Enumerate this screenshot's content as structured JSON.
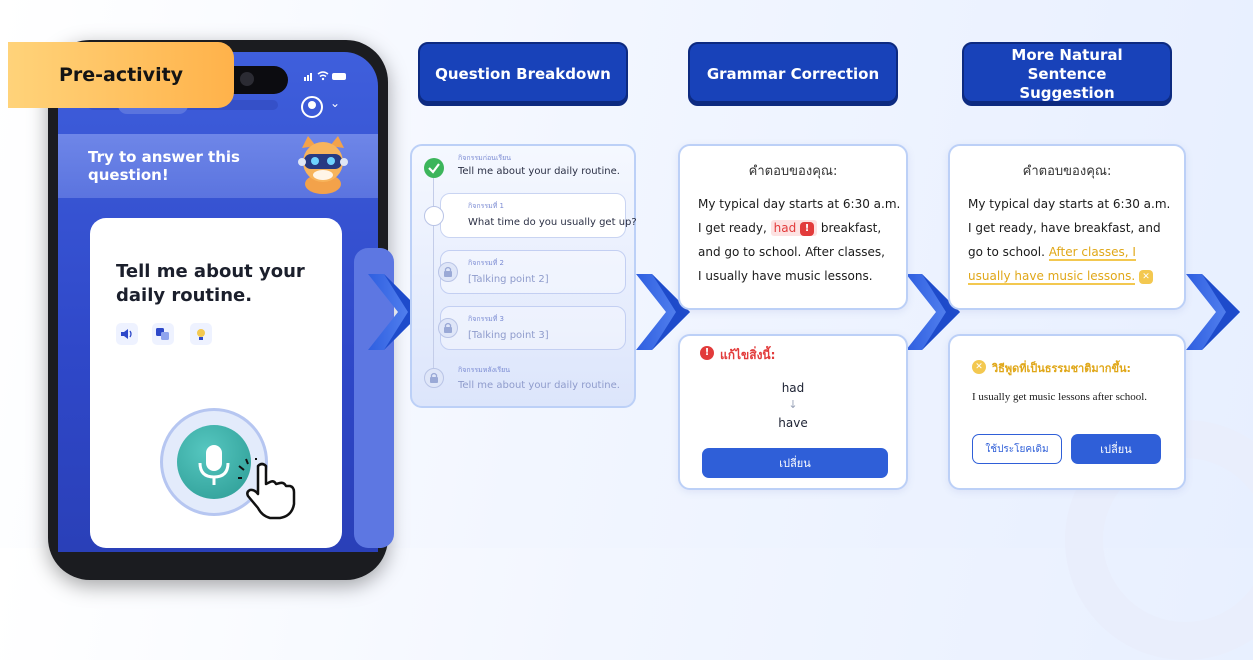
{
  "tag": {
    "label": "Pre-activity"
  },
  "phone": {
    "prompt": "Try to answer this question!",
    "question": "Tell me about your daily routine."
  },
  "headers": {
    "breakdown": "Question Breakdown",
    "grammar": "Grammar Correction",
    "natural": "More Natural Sentence Suggestion"
  },
  "breakdown": {
    "steps": [
      {
        "small": "กิจกรรมก่อนเรียน",
        "main": "Tell me about your daily routine."
      },
      {
        "small": "กิจกรรมที่ 1",
        "main": "What time do you usually get up?"
      },
      {
        "small": "กิจกรรมที่ 2",
        "main": "[Talking point 2]"
      },
      {
        "small": "กิจกรรมที่ 3",
        "main": "[Talking point 3]"
      },
      {
        "small": "กิจกรรมหลังเรียน",
        "main": "Tell me about your daily routine."
      }
    ]
  },
  "grammar": {
    "heading": "คำตอบของคุณ:",
    "line1": "My typical day starts at 6:30 a.m.",
    "line2_pre": "I get ready,",
    "line2_err": "had",
    "line2_post": "breakfast,",
    "line3": "and go to school.  After classes,",
    "line4": "I usually have music lessons.",
    "fix_heading": "แก้ไขสิ่งนี้:",
    "wrong": "had",
    "arrow": "↓",
    "right": "have",
    "change_btn": "เปลี่ยน"
  },
  "natural": {
    "heading": "คำตอบของคุณ:",
    "line1": "My typical day starts at 6:30 a.m.",
    "line2": "I get ready, have breakfast, and",
    "line3_pre": "go to school.",
    "line3_hl": "After classes, I",
    "line4_hl": "usually have music lessons.",
    "sugg_heading": "วิธีพูดที่เป็นธรรมชาติมากขึ้น:",
    "suggestion": "I usually get music lessons after school.",
    "keep_btn": "ใช้ประโยคเดิม",
    "change_btn": "เปลี่ยน"
  },
  "colors": {
    "accent": "#1842b9",
    "error": "#e23b3b",
    "suggestion": "#f3c850",
    "tag": "#ffb24a"
  }
}
